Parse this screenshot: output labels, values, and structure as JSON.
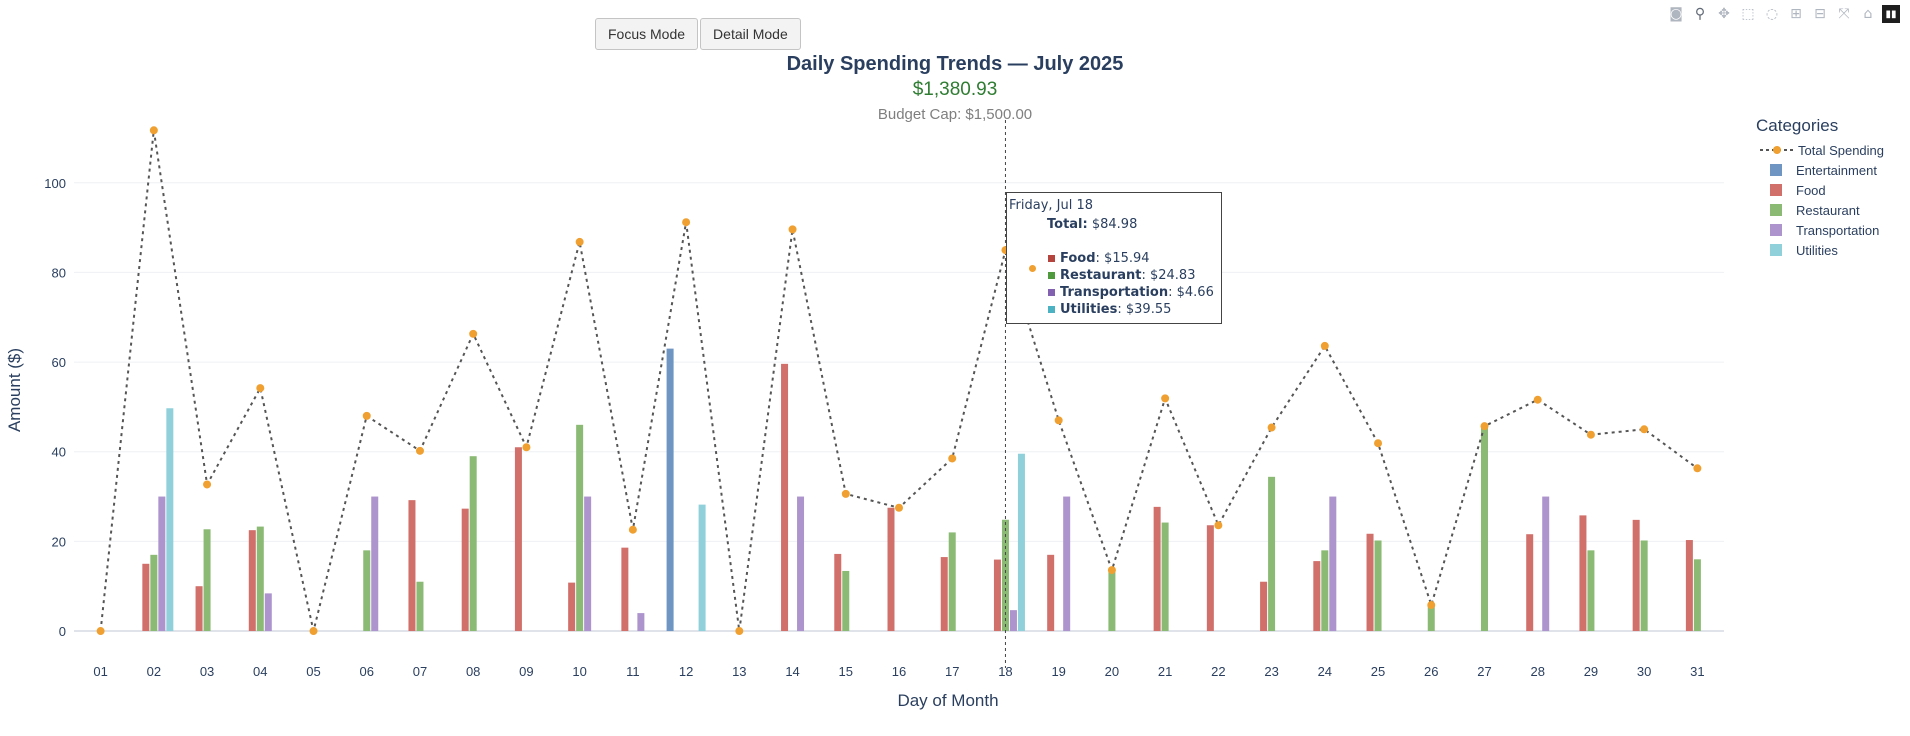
{
  "controls": {
    "focus_label": "Focus Mode",
    "detail_label": "Detail Mode"
  },
  "toolbar": {
    "icons": [
      "camera-icon",
      "zoom-icon",
      "pan-icon",
      "box-select-icon",
      "lasso-icon",
      "zoom-in-icon",
      "zoom-out-icon",
      "autoscale-icon",
      "reset-axes-icon",
      "plotly-logo-icon"
    ]
  },
  "header": {
    "title": "Daily Spending Trends — July 2025",
    "total": "$1,380.93",
    "budget_cap": "Budget Cap: $1,500.00"
  },
  "colors": {
    "Entertainment": "#6f95c2",
    "Food": "#d1706b",
    "Restaurant": "#8bba74",
    "Transportation": "#ad94cc",
    "Utilities": "#8fd0da",
    "total_line": "#555555",
    "total_marker": "#f0a030"
  },
  "legend": {
    "title": "Categories",
    "items": [
      "Total Spending",
      "Entertainment",
      "Food",
      "Restaurant",
      "Transportation",
      "Utilities"
    ]
  },
  "tooltip": {
    "date": "Friday, Jul 18",
    "total_label": "Total:",
    "total_value": "$84.98",
    "rows": [
      {
        "label": "Food",
        "value": ": $15.94"
      },
      {
        "label": "Restaurant",
        "value": ": $24.83"
      },
      {
        "label": "Transportation",
        "value": ": $4.66"
      },
      {
        "label": "Utilities",
        "value": ": $39.55"
      }
    ]
  },
  "chart_data": {
    "type": "bar",
    "title": "Daily Spending Trends — July 2025",
    "xlabel": "Day of Month",
    "ylabel": "Amount ($)",
    "ylim": [
      -2,
      114
    ],
    "yticks": [
      0,
      20,
      40,
      60,
      80,
      100
    ],
    "grid": true,
    "legend_position": "right",
    "categories": [
      "01",
      "02",
      "03",
      "04",
      "05",
      "06",
      "07",
      "08",
      "09",
      "10",
      "11",
      "12",
      "13",
      "14",
      "15",
      "16",
      "17",
      "18",
      "19",
      "20",
      "21",
      "22",
      "23",
      "24",
      "25",
      "26",
      "27",
      "28",
      "29",
      "30",
      "31"
    ],
    "series": [
      {
        "name": "Entertainment",
        "values": [
          0,
          0,
          0,
          0,
          0,
          0,
          0,
          0,
          0,
          0,
          0,
          63,
          0,
          0,
          0,
          0,
          0,
          0,
          0,
          0,
          0,
          0,
          0,
          0,
          0,
          0,
          0,
          0,
          0,
          0,
          0
        ]
      },
      {
        "name": "Food",
        "values": [
          0,
          15,
          10,
          22.5,
          0,
          0,
          29.2,
          27.3,
          41,
          10.8,
          18.6,
          0,
          0,
          59.6,
          17.2,
          27.5,
          16.5,
          15.94,
          17,
          0,
          27.7,
          23.6,
          11,
          15.6,
          21.7,
          0,
          0,
          21.6,
          25.8,
          24.8,
          20.3
        ]
      },
      {
        "name": "Restaurant",
        "values": [
          0,
          17,
          22.7,
          23.3,
          0,
          18,
          11,
          39,
          0,
          46,
          0,
          0,
          0,
          0,
          13.4,
          0,
          22,
          24.83,
          0,
          13.6,
          24.2,
          0,
          34.4,
          18,
          20.2,
          5.8,
          45.7,
          0,
          18,
          20.2,
          16
        ]
      },
      {
        "name": "Transportation",
        "values": [
          0,
          30,
          0,
          8.4,
          0,
          30,
          0,
          0,
          0,
          30,
          4,
          0,
          0,
          30,
          0,
          0,
          0,
          4.66,
          30,
          0,
          0,
          0,
          0,
          30,
          0,
          0,
          0,
          30,
          0,
          0,
          0
        ]
      },
      {
        "name": "Utilities",
        "values": [
          0,
          49.7,
          0,
          0,
          0,
          0,
          0,
          0,
          0,
          0,
          0,
          28.2,
          0,
          0,
          0,
          0,
          0,
          39.55,
          0,
          0,
          0,
          0,
          0,
          0,
          0,
          0,
          0,
          0,
          0,
          0,
          0
        ]
      }
    ],
    "total_series": {
      "name": "Total Spending",
      "type": "line",
      "values": [
        0,
        111.7,
        32.7,
        54.2,
        0,
        48,
        40.2,
        66.3,
        41,
        86.8,
        22.6,
        91.2,
        0,
        89.6,
        30.6,
        27.5,
        38.5,
        84.98,
        47,
        13.6,
        51.9,
        23.6,
        45.4,
        63.6,
        41.9,
        5.8,
        45.7,
        51.6,
        43.8,
        45,
        36.3
      ]
    },
    "hover_day": "18"
  }
}
